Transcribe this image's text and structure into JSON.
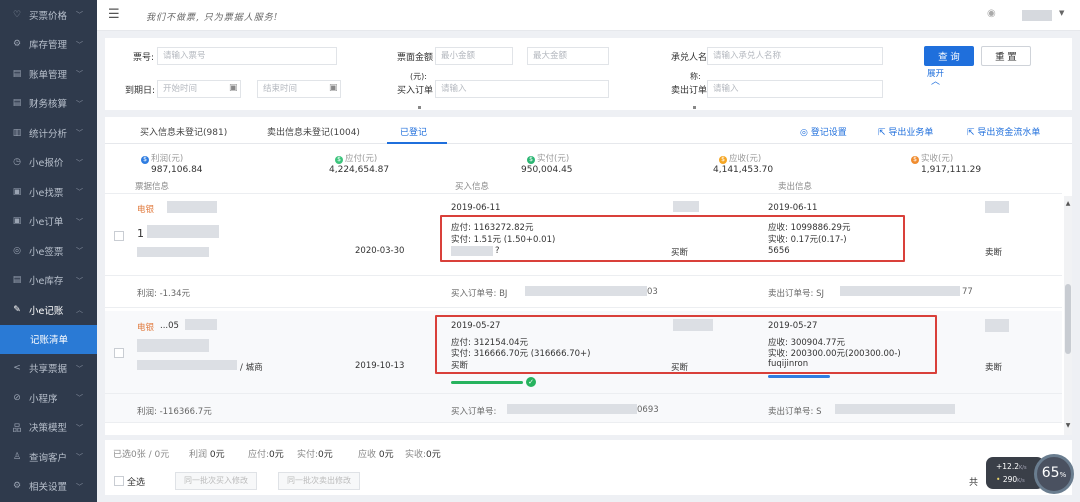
{
  "sidebar": {
    "items": [
      {
        "label": "买票价格",
        "icon": "map-pin-icon",
        "glyph": "♡"
      },
      {
        "label": "库存管理",
        "icon": "gear-icon",
        "glyph": "⚙"
      },
      {
        "label": "账单管理",
        "icon": "document-icon",
        "glyph": "▤"
      },
      {
        "label": "财务核算",
        "icon": "ledger-icon",
        "glyph": "▤"
      },
      {
        "label": "统计分析",
        "icon": "bar-chart-icon",
        "glyph": "▥"
      },
      {
        "label": "小e报价",
        "icon": "clock-icon",
        "glyph": "◷"
      },
      {
        "label": "小e找票",
        "icon": "file-search-icon",
        "glyph": "▣"
      },
      {
        "label": "小e订单",
        "icon": "order-icon",
        "glyph": "▣"
      },
      {
        "label": "小e签票",
        "icon": "shield-icon",
        "glyph": "◎"
      },
      {
        "label": "小e库存",
        "icon": "box-icon",
        "glyph": "▤"
      },
      {
        "label": "小e记账",
        "icon": "edit-icon",
        "glyph": "✎"
      }
    ],
    "sub_item": "记账清单",
    "bottom_items": [
      {
        "label": "共享票据",
        "icon": "share-icon",
        "glyph": "<"
      },
      {
        "label": "小程序",
        "icon": "miniapp-icon",
        "glyph": "⊘"
      },
      {
        "label": "决策模型",
        "icon": "model-icon",
        "glyph": "品"
      },
      {
        "label": "查询客户",
        "icon": "user-icon",
        "glyph": "♙"
      },
      {
        "label": "相关设置",
        "icon": "settings-icon",
        "glyph": "⚙"
      }
    ]
  },
  "topbar": {
    "slogan": "我们不做票, 只为票据人服务!"
  },
  "filter": {
    "piao_hao": {
      "label": "票号:",
      "placeholder": "请输入票号"
    },
    "amount": {
      "label": "票面金额",
      "label_unit": "(元):",
      "min_placeholder": "最小金额",
      "max_placeholder": "最大金额"
    },
    "acceptor": {
      "label": "承兑人名",
      "label_suffix": "称:",
      "placeholder": "请输入承兑人名称"
    },
    "due_date": {
      "label": "到期日:",
      "start_placeholder": "开始时间",
      "end_placeholder": "结束时间"
    },
    "buy_order": {
      "label": "买入订单",
      "placeholder": "请输入"
    },
    "sell_order": {
      "label": "卖出订单",
      "placeholder": "请输入"
    },
    "query_button": "查 询",
    "reset_button": "重 置",
    "expand": "展开"
  },
  "tabs": [
    {
      "label": "买入信息未登记(981)",
      "active": false
    },
    {
      "label": "卖出信息未登记(1004)",
      "active": false
    },
    {
      "label": "已登记",
      "active": true
    }
  ],
  "actions": {
    "register_settings": "登记设置",
    "export_business": "导出业务单",
    "export_flow": "导出资金流水单"
  },
  "summary": [
    {
      "label": "利润(元)",
      "value": "987,106.84",
      "color": "#2f7de1"
    },
    {
      "label": "应付(元)",
      "value": "4,224,654.87",
      "color": "#3cc47c"
    },
    {
      "label": "实付(元)",
      "value": "950,004.45",
      "color": "#2bb673"
    },
    {
      "label": "应收(元)",
      "value": "4,141,453.70",
      "color": "#f5a623"
    },
    {
      "label": "实收(元)",
      "value": "1,917,111.29",
      "color": "#f08c2e"
    }
  ],
  "columns": {
    "bill": "票据信息",
    "buy": "买入信息",
    "sell": "卖出信息"
  },
  "records": [
    {
      "bill_type": "电银",
      "bill_mid": "",
      "bill_id_prefix": "1",
      "due_date": "2020-03-30",
      "profit": "利润: -1.34元",
      "buy_date": "2019-06-11",
      "buy_payable": "应付: 1163272.82元",
      "buy_paid": "实付: 1.51元 (1.50+0.01)",
      "buy_name": "?",
      "buy_tag": "买断",
      "sell_date": "2019-06-11",
      "sell_receivable": "应收: 1099886.29元",
      "sell_received": "实收: 0.17元(0.17-)",
      "sell_name": "5656",
      "sell_tag": "卖断",
      "buy_order": "买入订单号: BJ",
      "buy_order_tail": "03",
      "sell_order": "卖出订单号: SJ",
      "sell_order_tail": "77"
    },
    {
      "bill_type": "电银",
      "bill_mid": "...05",
      "bill_id_prefix": "",
      "bank_suffix": "/ 城商",
      "due_date": "2019-10-13",
      "profit": "利润: -116366.7元",
      "buy_date": "2019-05-27",
      "buy_payable": "应付: 312154.04元",
      "buy_paid": "实付: 316666.70元 (316666.70+)",
      "buy_name": "买断",
      "buy_tag": "买断",
      "sell_date": "2019-05-27",
      "sell_receivable": "应收: 300904.77元",
      "sell_received": "实收: 200300.00元(200300.00-)",
      "sell_name": "fuqijinron",
      "sell_tag": "卖断",
      "buy_order": "买入订单号:",
      "buy_order_tail": "0693",
      "sell_order": "卖出订单号: S",
      "sell_order_tail": ""
    }
  ],
  "footer": {
    "selected": "已选0张 / 0元",
    "profit_label": "利润",
    "profit_val": "0元",
    "payable_label": "应付:",
    "payable_val": "0元",
    "paid_label": "实付:",
    "paid_val": "0元",
    "receivable_label": "应收",
    "receivable_val": "0元",
    "received_label": "实收:",
    "received_val": "0元",
    "select_all": "全选",
    "batch_buy": "同一批次买入修改",
    "batch_sell": "同一批次卖出修改",
    "total_prefix": "共"
  },
  "speed_widget": {
    "up": "+12.2",
    "up_unit": "K/s",
    "down": "290",
    "down_unit": "K/s",
    "percent": "65",
    "percent_unit": "%"
  }
}
